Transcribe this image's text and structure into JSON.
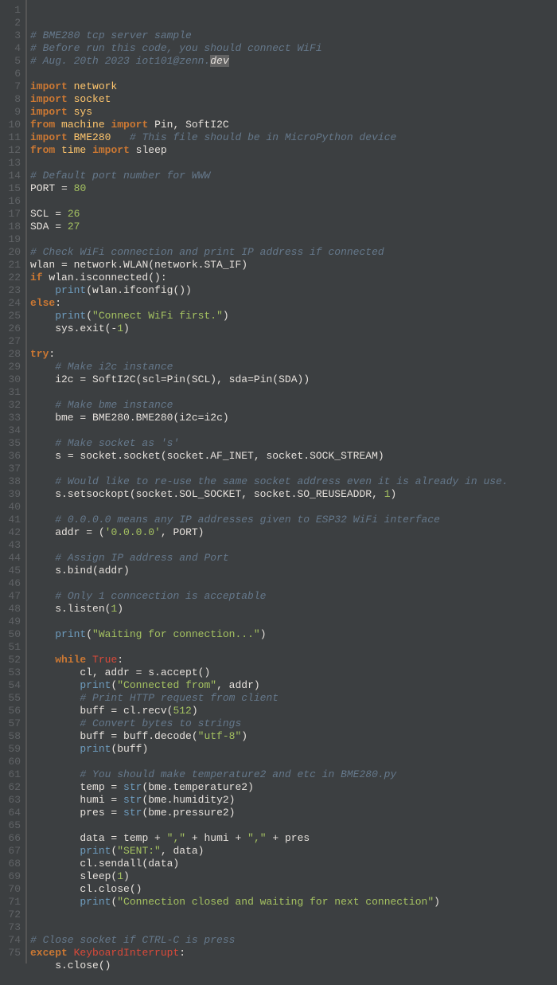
{
  "lines": [
    {
      "n": 1,
      "tokens": [
        {
          "t": "# BME280 tcp server sample",
          "c": "c-comment"
        }
      ]
    },
    {
      "n": 2,
      "tokens": [
        {
          "t": "# Before run this code, you should connect WiFi",
          "c": "c-comment"
        }
      ]
    },
    {
      "n": 3,
      "tokens": [
        {
          "t": "# Aug. 20th 2023 iot101@zenn.",
          "c": "c-comment"
        },
        {
          "t": "dev",
          "c": "c-comment hl-sel"
        }
      ]
    },
    {
      "n": 4,
      "tokens": []
    },
    {
      "n": 5,
      "tokens": [
        {
          "t": "import",
          "c": "c-kw"
        },
        {
          "t": " ",
          "c": ""
        },
        {
          "t": "network",
          "c": "c-mod"
        }
      ]
    },
    {
      "n": 6,
      "tokens": [
        {
          "t": "import",
          "c": "c-kw"
        },
        {
          "t": " ",
          "c": ""
        },
        {
          "t": "socket",
          "c": "c-mod"
        }
      ]
    },
    {
      "n": 7,
      "tokens": [
        {
          "t": "import",
          "c": "c-kw"
        },
        {
          "t": " ",
          "c": ""
        },
        {
          "t": "sys",
          "c": "c-mod"
        }
      ]
    },
    {
      "n": 8,
      "tokens": [
        {
          "t": "from",
          "c": "c-kw"
        },
        {
          "t": " ",
          "c": ""
        },
        {
          "t": "machine",
          "c": "c-mod"
        },
        {
          "t": " ",
          "c": ""
        },
        {
          "t": "import",
          "c": "c-kw"
        },
        {
          "t": " Pin, SoftI2C",
          "c": "c-ident"
        }
      ]
    },
    {
      "n": 9,
      "tokens": [
        {
          "t": "import",
          "c": "c-kw"
        },
        {
          "t": " ",
          "c": ""
        },
        {
          "t": "BME280",
          "c": "c-mod"
        },
        {
          "t": "   ",
          "c": ""
        },
        {
          "t": "# This file should be in MicroPython device",
          "c": "c-comment"
        }
      ]
    },
    {
      "n": 10,
      "tokens": [
        {
          "t": "from",
          "c": "c-kw"
        },
        {
          "t": " ",
          "c": ""
        },
        {
          "t": "time",
          "c": "c-mod"
        },
        {
          "t": " ",
          "c": ""
        },
        {
          "t": "import",
          "c": "c-kw"
        },
        {
          "t": " sleep",
          "c": "c-ident"
        }
      ]
    },
    {
      "n": 11,
      "tokens": []
    },
    {
      "n": 12,
      "tokens": [
        {
          "t": "# Default port number for WWW",
          "c": "c-comment"
        }
      ]
    },
    {
      "n": 13,
      "tokens": [
        {
          "t": "PORT ",
          "c": "c-ident"
        },
        {
          "t": "=",
          "c": "c-punc"
        },
        {
          "t": " ",
          "c": ""
        },
        {
          "t": "80",
          "c": "c-num"
        }
      ]
    },
    {
      "n": 14,
      "tokens": []
    },
    {
      "n": 15,
      "tokens": [
        {
          "t": "SCL ",
          "c": "c-ident"
        },
        {
          "t": "=",
          "c": "c-punc"
        },
        {
          "t": " ",
          "c": ""
        },
        {
          "t": "26",
          "c": "c-num"
        }
      ]
    },
    {
      "n": 16,
      "tokens": [
        {
          "t": "SDA ",
          "c": "c-ident"
        },
        {
          "t": "=",
          "c": "c-punc"
        },
        {
          "t": " ",
          "c": ""
        },
        {
          "t": "27",
          "c": "c-num"
        }
      ]
    },
    {
      "n": 17,
      "tokens": []
    },
    {
      "n": 18,
      "tokens": [
        {
          "t": "# Check WiFi connection and print IP address if connected",
          "c": "c-comment"
        }
      ]
    },
    {
      "n": 19,
      "tokens": [
        {
          "t": "wlan ",
          "c": "c-ident"
        },
        {
          "t": "=",
          "c": "c-punc"
        },
        {
          "t": " network.WLAN(network.STA_IF)",
          "c": "c-ident"
        }
      ]
    },
    {
      "n": 20,
      "tokens": [
        {
          "t": "if",
          "c": "c-kw"
        },
        {
          "t": " wlan.isconnected():",
          "c": "c-ident"
        }
      ]
    },
    {
      "n": 21,
      "tokens": [
        {
          "t": "    ",
          "c": ""
        },
        {
          "t": "print",
          "c": "c-builtin"
        },
        {
          "t": "(wlan.ifconfig())",
          "c": "c-ident"
        }
      ]
    },
    {
      "n": 22,
      "tokens": [
        {
          "t": "else",
          "c": "c-kw"
        },
        {
          "t": ":",
          "c": "c-punc"
        }
      ]
    },
    {
      "n": 23,
      "tokens": [
        {
          "t": "    ",
          "c": ""
        },
        {
          "t": "print",
          "c": "c-builtin"
        },
        {
          "t": "(",
          "c": "c-punc"
        },
        {
          "t": "\"Connect WiFi first.\"",
          "c": "c-str"
        },
        {
          "t": ")",
          "c": "c-punc"
        }
      ]
    },
    {
      "n": 24,
      "tokens": [
        {
          "t": "    sys.exit(",
          "c": "c-ident"
        },
        {
          "t": "-",
          "c": "c-punc"
        },
        {
          "t": "1",
          "c": "c-num"
        },
        {
          "t": ")",
          "c": "c-punc"
        }
      ]
    },
    {
      "n": 25,
      "tokens": []
    },
    {
      "n": 26,
      "tokens": [
        {
          "t": "try",
          "c": "c-kw"
        },
        {
          "t": ":",
          "c": "c-punc"
        }
      ]
    },
    {
      "n": 27,
      "tokens": [
        {
          "t": "    ",
          "c": ""
        },
        {
          "t": "# Make i2c instance",
          "c": "c-comment"
        }
      ]
    },
    {
      "n": 28,
      "tokens": [
        {
          "t": "    i2c ",
          "c": "c-ident"
        },
        {
          "t": "=",
          "c": "c-punc"
        },
        {
          "t": " SoftI2C(scl",
          "c": "c-ident"
        },
        {
          "t": "=",
          "c": "c-punc"
        },
        {
          "t": "Pin(SCL), sda",
          "c": "c-ident"
        },
        {
          "t": "=",
          "c": "c-punc"
        },
        {
          "t": "Pin(SDA))",
          "c": "c-ident"
        }
      ]
    },
    {
      "n": 29,
      "tokens": []
    },
    {
      "n": 30,
      "tokens": [
        {
          "t": "    ",
          "c": ""
        },
        {
          "t": "# Make bme instance",
          "c": "c-comment"
        }
      ]
    },
    {
      "n": 31,
      "tokens": [
        {
          "t": "    bme ",
          "c": "c-ident"
        },
        {
          "t": "=",
          "c": "c-punc"
        },
        {
          "t": " BME280.BME280(i2c",
          "c": "c-ident"
        },
        {
          "t": "=",
          "c": "c-punc"
        },
        {
          "t": "i2c)",
          "c": "c-ident"
        }
      ]
    },
    {
      "n": 32,
      "tokens": []
    },
    {
      "n": 33,
      "tokens": [
        {
          "t": "    ",
          "c": ""
        },
        {
          "t": "# Make socket as 's'",
          "c": "c-comment"
        }
      ]
    },
    {
      "n": 34,
      "tokens": [
        {
          "t": "    s ",
          "c": "c-ident"
        },
        {
          "t": "=",
          "c": "c-punc"
        },
        {
          "t": " socket.socket(socket.AF_INET, socket.SOCK_STREAM)",
          "c": "c-ident"
        }
      ]
    },
    {
      "n": 35,
      "tokens": []
    },
    {
      "n": 36,
      "tokens": [
        {
          "t": "    ",
          "c": ""
        },
        {
          "t": "# Would like to re-use the same socket address even it is already in use.",
          "c": "c-comment"
        }
      ]
    },
    {
      "n": 37,
      "tokens": [
        {
          "t": "    s.setsockopt(socket.SOL_SOCKET, socket.SO_REUSEADDR, ",
          "c": "c-ident"
        },
        {
          "t": "1",
          "c": "c-num"
        },
        {
          "t": ")",
          "c": "c-punc"
        }
      ]
    },
    {
      "n": 38,
      "tokens": []
    },
    {
      "n": 39,
      "tokens": [
        {
          "t": "    ",
          "c": ""
        },
        {
          "t": "# 0.0.0.0 means any IP addresses given to ESP32 WiFi interface",
          "c": "c-comment"
        }
      ]
    },
    {
      "n": 40,
      "tokens": [
        {
          "t": "    addr ",
          "c": "c-ident"
        },
        {
          "t": "=",
          "c": "c-punc"
        },
        {
          "t": " (",
          "c": "c-punc"
        },
        {
          "t": "'0.0.0.0'",
          "c": "c-str"
        },
        {
          "t": ", PORT)",
          "c": "c-ident"
        }
      ]
    },
    {
      "n": 41,
      "tokens": []
    },
    {
      "n": 42,
      "tokens": [
        {
          "t": "    ",
          "c": ""
        },
        {
          "t": "# Assign IP address and Port",
          "c": "c-comment"
        }
      ]
    },
    {
      "n": 43,
      "tokens": [
        {
          "t": "    s.bind(addr)",
          "c": "c-ident"
        }
      ]
    },
    {
      "n": 44,
      "tokens": []
    },
    {
      "n": 45,
      "tokens": [
        {
          "t": "    ",
          "c": ""
        },
        {
          "t": "# Only 1 conncection is acceptable",
          "c": "c-comment"
        }
      ]
    },
    {
      "n": 46,
      "tokens": [
        {
          "t": "    s.listen(",
          "c": "c-ident"
        },
        {
          "t": "1",
          "c": "c-num"
        },
        {
          "t": ")",
          "c": "c-punc"
        }
      ]
    },
    {
      "n": 47,
      "tokens": []
    },
    {
      "n": 48,
      "tokens": [
        {
          "t": "    ",
          "c": ""
        },
        {
          "t": "print",
          "c": "c-builtin"
        },
        {
          "t": "(",
          "c": "c-punc"
        },
        {
          "t": "\"Waiting for connection...\"",
          "c": "c-str"
        },
        {
          "t": ")",
          "c": "c-punc"
        }
      ]
    },
    {
      "n": 49,
      "tokens": []
    },
    {
      "n": 50,
      "tokens": [
        {
          "t": "    ",
          "c": ""
        },
        {
          "t": "while",
          "c": "c-kw"
        },
        {
          "t": " ",
          "c": ""
        },
        {
          "t": "True",
          "c": "c-const"
        },
        {
          "t": ":",
          "c": "c-punc"
        }
      ]
    },
    {
      "n": 51,
      "tokens": [
        {
          "t": "        cl, addr ",
          "c": "c-ident"
        },
        {
          "t": "=",
          "c": "c-punc"
        },
        {
          "t": " s.accept()",
          "c": "c-ident"
        }
      ]
    },
    {
      "n": 52,
      "tokens": [
        {
          "t": "        ",
          "c": ""
        },
        {
          "t": "print",
          "c": "c-builtin"
        },
        {
          "t": "(",
          "c": "c-punc"
        },
        {
          "t": "\"Connected from\"",
          "c": "c-str"
        },
        {
          "t": ", addr)",
          "c": "c-ident"
        }
      ]
    },
    {
      "n": 53,
      "tokens": [
        {
          "t": "        ",
          "c": ""
        },
        {
          "t": "# Print HTTP request from client",
          "c": "c-comment"
        }
      ]
    },
    {
      "n": 54,
      "tokens": [
        {
          "t": "        buff ",
          "c": "c-ident"
        },
        {
          "t": "=",
          "c": "c-punc"
        },
        {
          "t": " cl.recv(",
          "c": "c-ident"
        },
        {
          "t": "512",
          "c": "c-num"
        },
        {
          "t": ")",
          "c": "c-punc"
        }
      ]
    },
    {
      "n": 55,
      "tokens": [
        {
          "t": "        ",
          "c": ""
        },
        {
          "t": "# Convert bytes to strings",
          "c": "c-comment"
        }
      ]
    },
    {
      "n": 56,
      "tokens": [
        {
          "t": "        buff ",
          "c": "c-ident"
        },
        {
          "t": "=",
          "c": "c-punc"
        },
        {
          "t": " buff.decode(",
          "c": "c-ident"
        },
        {
          "t": "\"utf-8\"",
          "c": "c-str"
        },
        {
          "t": ")",
          "c": "c-punc"
        }
      ]
    },
    {
      "n": 57,
      "tokens": [
        {
          "t": "        ",
          "c": ""
        },
        {
          "t": "print",
          "c": "c-builtin"
        },
        {
          "t": "(buff)",
          "c": "c-ident"
        }
      ]
    },
    {
      "n": 58,
      "tokens": []
    },
    {
      "n": 59,
      "tokens": [
        {
          "t": "        ",
          "c": ""
        },
        {
          "t": "# You should make temperature2 and etc in BME280.py",
          "c": "c-comment"
        }
      ]
    },
    {
      "n": 60,
      "tokens": [
        {
          "t": "        temp ",
          "c": "c-ident"
        },
        {
          "t": "=",
          "c": "c-punc"
        },
        {
          "t": " ",
          "c": ""
        },
        {
          "t": "str",
          "c": "c-builtin"
        },
        {
          "t": "(bme.temperature2)",
          "c": "c-ident"
        }
      ]
    },
    {
      "n": 61,
      "tokens": [
        {
          "t": "        humi ",
          "c": "c-ident"
        },
        {
          "t": "=",
          "c": "c-punc"
        },
        {
          "t": " ",
          "c": ""
        },
        {
          "t": "str",
          "c": "c-builtin"
        },
        {
          "t": "(bme.humidity2)",
          "c": "c-ident"
        }
      ]
    },
    {
      "n": 62,
      "tokens": [
        {
          "t": "        pres ",
          "c": "c-ident"
        },
        {
          "t": "=",
          "c": "c-punc"
        },
        {
          "t": " ",
          "c": ""
        },
        {
          "t": "str",
          "c": "c-builtin"
        },
        {
          "t": "(bme.pressure2)",
          "c": "c-ident"
        }
      ]
    },
    {
      "n": 63,
      "tokens": []
    },
    {
      "n": 64,
      "tokens": [
        {
          "t": "        data ",
          "c": "c-ident"
        },
        {
          "t": "=",
          "c": "c-punc"
        },
        {
          "t": " temp ",
          "c": "c-ident"
        },
        {
          "t": "+",
          "c": "c-punc"
        },
        {
          "t": " ",
          "c": ""
        },
        {
          "t": "\",\"",
          "c": "c-str"
        },
        {
          "t": " ",
          "c": ""
        },
        {
          "t": "+",
          "c": "c-punc"
        },
        {
          "t": " humi ",
          "c": "c-ident"
        },
        {
          "t": "+",
          "c": "c-punc"
        },
        {
          "t": " ",
          "c": ""
        },
        {
          "t": "\",\"",
          "c": "c-str"
        },
        {
          "t": " ",
          "c": ""
        },
        {
          "t": "+",
          "c": "c-punc"
        },
        {
          "t": " pres",
          "c": "c-ident"
        }
      ]
    },
    {
      "n": 65,
      "tokens": [
        {
          "t": "        ",
          "c": ""
        },
        {
          "t": "print",
          "c": "c-builtin"
        },
        {
          "t": "(",
          "c": "c-punc"
        },
        {
          "t": "\"SENT:\"",
          "c": "c-str"
        },
        {
          "t": ", data)",
          "c": "c-ident"
        }
      ]
    },
    {
      "n": 66,
      "tokens": [
        {
          "t": "        cl.sendall(data)",
          "c": "c-ident"
        }
      ]
    },
    {
      "n": 67,
      "tokens": [
        {
          "t": "        sleep(",
          "c": "c-ident"
        },
        {
          "t": "1",
          "c": "c-num"
        },
        {
          "t": ")",
          "c": "c-punc"
        }
      ]
    },
    {
      "n": 68,
      "tokens": [
        {
          "t": "        cl.close()",
          "c": "c-ident"
        }
      ]
    },
    {
      "n": 69,
      "tokens": [
        {
          "t": "        ",
          "c": ""
        },
        {
          "t": "print",
          "c": "c-builtin"
        },
        {
          "t": "(",
          "c": "c-punc"
        },
        {
          "t": "\"Connection closed and waiting for next connection\"",
          "c": "c-str"
        },
        {
          "t": ")",
          "c": "c-punc"
        }
      ]
    },
    {
      "n": 70,
      "tokens": []
    },
    {
      "n": 71,
      "tokens": []
    },
    {
      "n": 72,
      "tokens": [
        {
          "t": "# Close socket if CTRL-C is press",
          "c": "c-comment"
        }
      ]
    },
    {
      "n": 73,
      "tokens": [
        {
          "t": "except",
          "c": "c-kw"
        },
        {
          "t": " ",
          "c": ""
        },
        {
          "t": "KeyboardInterrupt",
          "c": "c-class"
        },
        {
          "t": ":",
          "c": "c-punc"
        }
      ]
    },
    {
      "n": 74,
      "tokens": [
        {
          "t": "    s.close()",
          "c": "c-ident"
        }
      ]
    },
    {
      "n": 75,
      "tokens": []
    }
  ]
}
